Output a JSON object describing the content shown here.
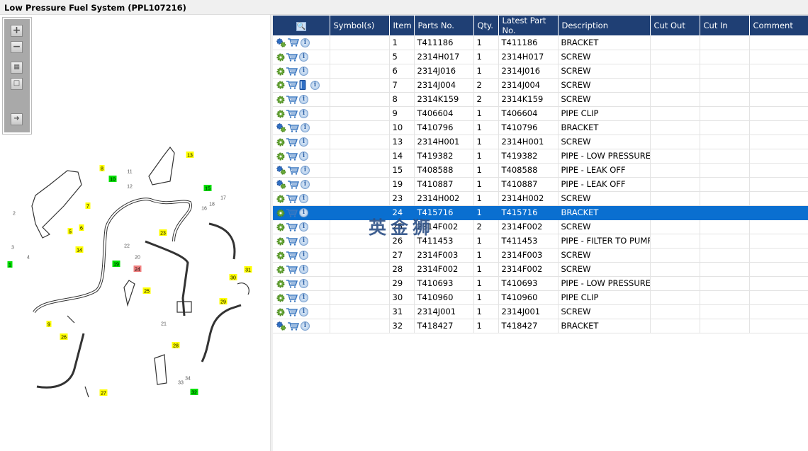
{
  "title": "Low Pressure Fuel System (PPL107216)",
  "toolbar": {
    "zoom_in": "+",
    "zoom_out": "−",
    "fit": "fit-icon",
    "actual": "actual-size-icon",
    "export": "export-icon"
  },
  "watermark": "英金狮",
  "colors": {
    "header": "#1f3f74",
    "selected": "#0a6fd0",
    "callout_yellow": "#ffff00",
    "callout_green": "#00e000",
    "callout_red": "#f08080"
  },
  "diagram": {
    "callouts": [
      {
        "t": "8",
        "c": "y"
      },
      {
        "t": "13",
        "c": "y"
      },
      {
        "t": "10",
        "c": "g"
      },
      {
        "t": "11",
        "c": "n"
      },
      {
        "t": "12",
        "c": "n"
      },
      {
        "t": "15",
        "c": "g"
      },
      {
        "t": "17",
        "c": "n"
      },
      {
        "t": "18",
        "c": "n"
      },
      {
        "t": "16",
        "c": "n"
      },
      {
        "t": "7",
        "c": "y"
      },
      {
        "t": "2",
        "c": "n"
      },
      {
        "t": "5",
        "c": "y"
      },
      {
        "t": "6",
        "c": "y"
      },
      {
        "t": "3",
        "c": "n"
      },
      {
        "t": "4",
        "c": "n"
      },
      {
        "t": "1",
        "c": "g"
      },
      {
        "t": "14",
        "c": "y"
      },
      {
        "t": "23",
        "c": "y"
      },
      {
        "t": "22",
        "c": "n"
      },
      {
        "t": "20",
        "c": "n"
      },
      {
        "t": "19",
        "c": "g"
      },
      {
        "t": "24",
        "c": "r"
      },
      {
        "t": "31",
        "c": "y"
      },
      {
        "t": "30",
        "c": "y"
      },
      {
        "t": "25",
        "c": "y"
      },
      {
        "t": "29",
        "c": "y"
      },
      {
        "t": "9",
        "c": "y"
      },
      {
        "t": "21",
        "c": "n"
      },
      {
        "t": "26",
        "c": "y"
      },
      {
        "t": "28",
        "c": "y"
      },
      {
        "t": "34",
        "c": "n"
      },
      {
        "t": "33",
        "c": "n"
      },
      {
        "t": "32",
        "c": "g"
      },
      {
        "t": "27",
        "c": "y"
      }
    ]
  },
  "table": {
    "columns": [
      "",
      "Symbol(s)",
      "Item",
      "Parts No.",
      "Qty.",
      "Latest Part No.",
      "Description",
      "Cut Out",
      "Cut In",
      "Comment"
    ],
    "rows": [
      {
        "multi": true,
        "book": false,
        "item": "1",
        "part": "T411186",
        "qty": "1",
        "latest": "T411186",
        "desc": "BRACKET"
      },
      {
        "multi": false,
        "book": false,
        "item": "5",
        "part": "2314H017",
        "qty": "1",
        "latest": "2314H017",
        "desc": "SCREW"
      },
      {
        "multi": false,
        "book": false,
        "item": "6",
        "part": "2314J016",
        "qty": "1",
        "latest": "2314J016",
        "desc": "SCREW"
      },
      {
        "multi": false,
        "book": true,
        "item": "7",
        "part": "2314J004",
        "qty": "2",
        "latest": "2314J004",
        "desc": "SCREW"
      },
      {
        "multi": false,
        "book": false,
        "item": "8",
        "part": "2314K159",
        "qty": "2",
        "latest": "2314K159",
        "desc": "SCREW"
      },
      {
        "multi": false,
        "book": false,
        "item": "9",
        "part": "T406604",
        "qty": "1",
        "latest": "T406604",
        "desc": "PIPE CLIP"
      },
      {
        "multi": true,
        "book": false,
        "item": "10",
        "part": "T410796",
        "qty": "1",
        "latest": "T410796",
        "desc": "BRACKET"
      },
      {
        "multi": false,
        "book": false,
        "item": "13",
        "part": "2314H001",
        "qty": "1",
        "latest": "2314H001",
        "desc": "SCREW"
      },
      {
        "multi": false,
        "book": false,
        "item": "14",
        "part": "T419382",
        "qty": "1",
        "latest": "T419382",
        "desc": "PIPE - LOW PRESSURE FU"
      },
      {
        "multi": true,
        "book": false,
        "item": "15",
        "part": "T408588",
        "qty": "1",
        "latest": "T408588",
        "desc": "PIPE - LEAK OFF"
      },
      {
        "multi": true,
        "book": false,
        "item": "19",
        "part": "T410887",
        "qty": "1",
        "latest": "T410887",
        "desc": "PIPE - LEAK OFF"
      },
      {
        "multi": false,
        "book": false,
        "item": "23",
        "part": "2314H002",
        "qty": "1",
        "latest": "2314H002",
        "desc": "SCREW"
      },
      {
        "multi": false,
        "book": false,
        "item": "24",
        "part": "T415716",
        "qty": "1",
        "latest": "T415716",
        "desc": "BRACKET",
        "selected": true
      },
      {
        "multi": false,
        "book": false,
        "item": "25",
        "part": "2314F002",
        "qty": "2",
        "latest": "2314F002",
        "desc": "SCREW"
      },
      {
        "multi": false,
        "book": false,
        "item": "26",
        "part": "T411453",
        "qty": "1",
        "latest": "T411453",
        "desc": "PIPE - FILTER TO PUMP"
      },
      {
        "multi": false,
        "book": false,
        "item": "27",
        "part": "2314F003",
        "qty": "1",
        "latest": "2314F003",
        "desc": "SCREW"
      },
      {
        "multi": false,
        "book": false,
        "item": "28",
        "part": "2314F002",
        "qty": "1",
        "latest": "2314F002",
        "desc": "SCREW"
      },
      {
        "multi": false,
        "book": false,
        "item": "29",
        "part": "T410693",
        "qty": "1",
        "latest": "T410693",
        "desc": "PIPE - LOW PRESSURE FU"
      },
      {
        "multi": false,
        "book": false,
        "item": "30",
        "part": "T410960",
        "qty": "1",
        "latest": "T410960",
        "desc": "PIPE CLIP"
      },
      {
        "multi": false,
        "book": false,
        "item": "31",
        "part": "2314J001",
        "qty": "1",
        "latest": "2314J001",
        "desc": "SCREW"
      },
      {
        "multi": true,
        "book": false,
        "item": "32",
        "part": "T418427",
        "qty": "1",
        "latest": "T418427",
        "desc": "BRACKET"
      }
    ]
  }
}
